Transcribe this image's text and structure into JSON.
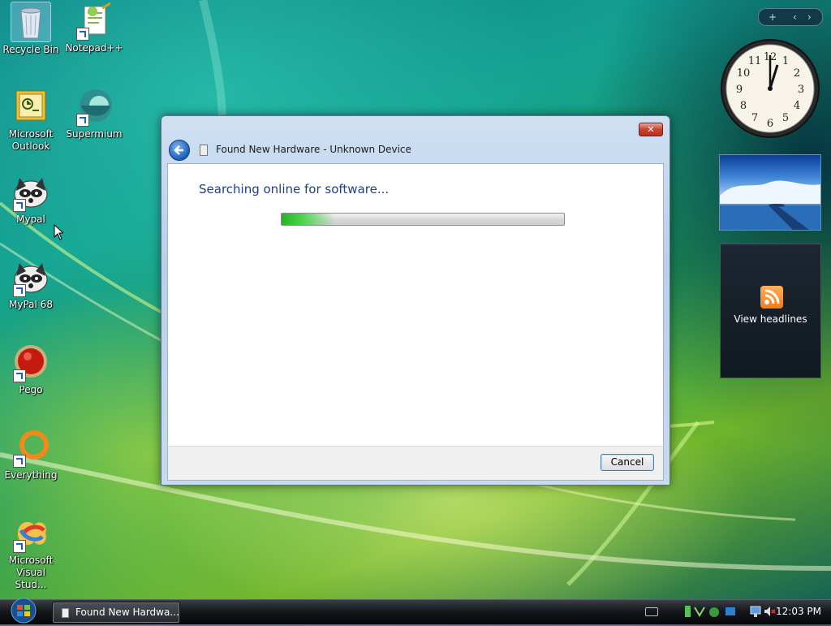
{
  "desktop": {
    "icons": [
      {
        "label": "Recycle Bin",
        "icon": "recycle-bin-icon"
      },
      {
        "label": "Notepad++",
        "icon": "notepadpp-icon"
      },
      {
        "label": "Microsoft Outlook",
        "icon": "outlook-icon"
      },
      {
        "label": "Supermium",
        "icon": "supermium-icon"
      },
      {
        "label": "Mypal",
        "icon": "mypal-icon"
      },
      {
        "label": "MyPal 68",
        "icon": "mypal68-icon"
      },
      {
        "label": "Pego",
        "icon": "pego-icon"
      },
      {
        "label": "Everything",
        "icon": "everything-icon"
      },
      {
        "label": "Microsoft Visual Stud...",
        "icon": "visual-studio-icon"
      }
    ]
  },
  "dialog": {
    "title": "Found New Hardware - Unknown Device",
    "heading": "Searching online for software...",
    "progress": 0.19,
    "cancel_label": "Cancel",
    "close_glyph": "✕"
  },
  "sidebar": {
    "controls": {
      "add": "+",
      "prev": "‹",
      "next": "›"
    },
    "feed_label": "View headlines"
  },
  "taskbar": {
    "task_label": "Found New Hardwa...",
    "clock": "12:03 PM"
  },
  "colors": {
    "dialog_heading": "#1e3f8a",
    "progress_green": "#22b422",
    "close_red": "#c9412f"
  }
}
